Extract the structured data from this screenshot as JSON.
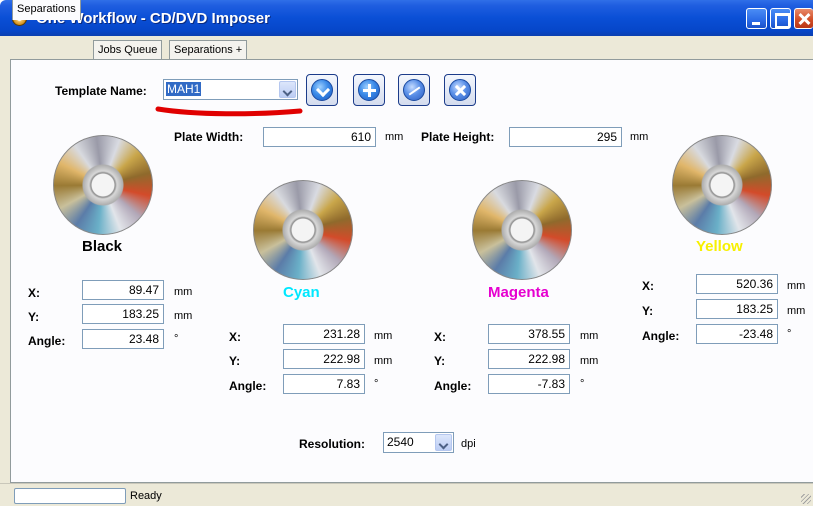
{
  "window": {
    "title": "One Workflow - CD/DVD Imposer"
  },
  "tabs": [
    "Separations",
    "Jobs Queue",
    "Separations +"
  ],
  "template": {
    "label": "Template Name:",
    "value": "MAH1"
  },
  "plate": {
    "width_label": "Plate Width:",
    "width_value": "610",
    "height_label": "Plate Height:",
    "height_value": "295",
    "unit": "mm"
  },
  "separations": [
    {
      "name": "Black",
      "color": "#000000",
      "x": "89.47",
      "y": "183.25",
      "angle": "23.48"
    },
    {
      "name": "Cyan",
      "color": "#00e8ff",
      "x": "231.28",
      "y": "222.98",
      "angle": "7.83"
    },
    {
      "name": "Magenta",
      "color": "#e600d0",
      "x": "378.55",
      "y": "222.98",
      "angle": "-7.83"
    },
    {
      "name": "Yellow",
      "color": "#f7f000",
      "x": "520.36",
      "y": "183.25",
      "angle": "-23.48"
    }
  ],
  "field_labels": {
    "x": "X:",
    "y": "Y:",
    "angle": "Angle:",
    "mm": "mm",
    "deg": "°"
  },
  "resolution": {
    "label": "Resolution:",
    "value": "2540",
    "unit": "dpi"
  },
  "status": {
    "text": "Ready"
  },
  "toolbar_icons": [
    "download-icon",
    "add-icon",
    "edit-icon",
    "delete-icon"
  ],
  "colors": {
    "annotation": "#e00000",
    "titlebar": "#0a4fd6"
  }
}
